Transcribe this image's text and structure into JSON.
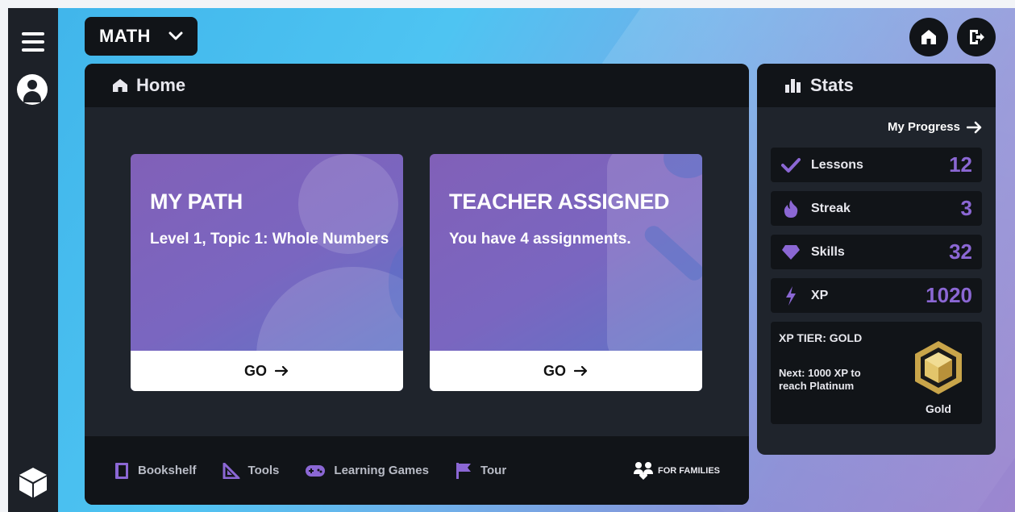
{
  "nav": {
    "menu_icon": "hamburger-icon",
    "avatar_icon": "user-icon",
    "logo_icon": "cube-icon"
  },
  "subject_selector": {
    "value": "MATH"
  },
  "top_buttons": {
    "home_icon": "home-icon",
    "logout_icon": "logout-icon"
  },
  "home_panel": {
    "title": "Home",
    "cards": [
      {
        "title": "MY PATH",
        "subtitle": "Level 1, Topic 1: Whole Numbers",
        "action": "GO"
      },
      {
        "title": "TEACHER ASSIGNED",
        "subtitle": "You have 4 assignments.",
        "action": "GO"
      }
    ],
    "footer": [
      {
        "label": "Bookshelf",
        "icon": "bookshelf-icon"
      },
      {
        "label": "Tools",
        "icon": "ruler-triangle-icon"
      },
      {
        "label": "Learning Games",
        "icon": "gamepad-icon"
      },
      {
        "label": "Tour",
        "icon": "flag-icon"
      }
    ],
    "families_label": "FOR FAMILIES"
  },
  "stats_panel": {
    "title": "Stats",
    "my_progress": "My Progress",
    "rows": [
      {
        "label": "Lessons",
        "value": "12",
        "icon": "check-icon"
      },
      {
        "label": "Streak",
        "value": "3",
        "icon": "flame-icon"
      },
      {
        "label": "Skills",
        "value": "32",
        "icon": "diamond-icon"
      },
      {
        "label": "XP",
        "value": "1020",
        "icon": "lightning-icon"
      }
    ],
    "tier": {
      "title": "XP TIER: GOLD",
      "next": "Next: 1000 XP to reach Platinum",
      "badge_label": "Gold"
    }
  },
  "colors": {
    "accent": "#8b67d4",
    "panel": "#1f242c",
    "header": "#111418",
    "gold": "#d8b85a"
  }
}
